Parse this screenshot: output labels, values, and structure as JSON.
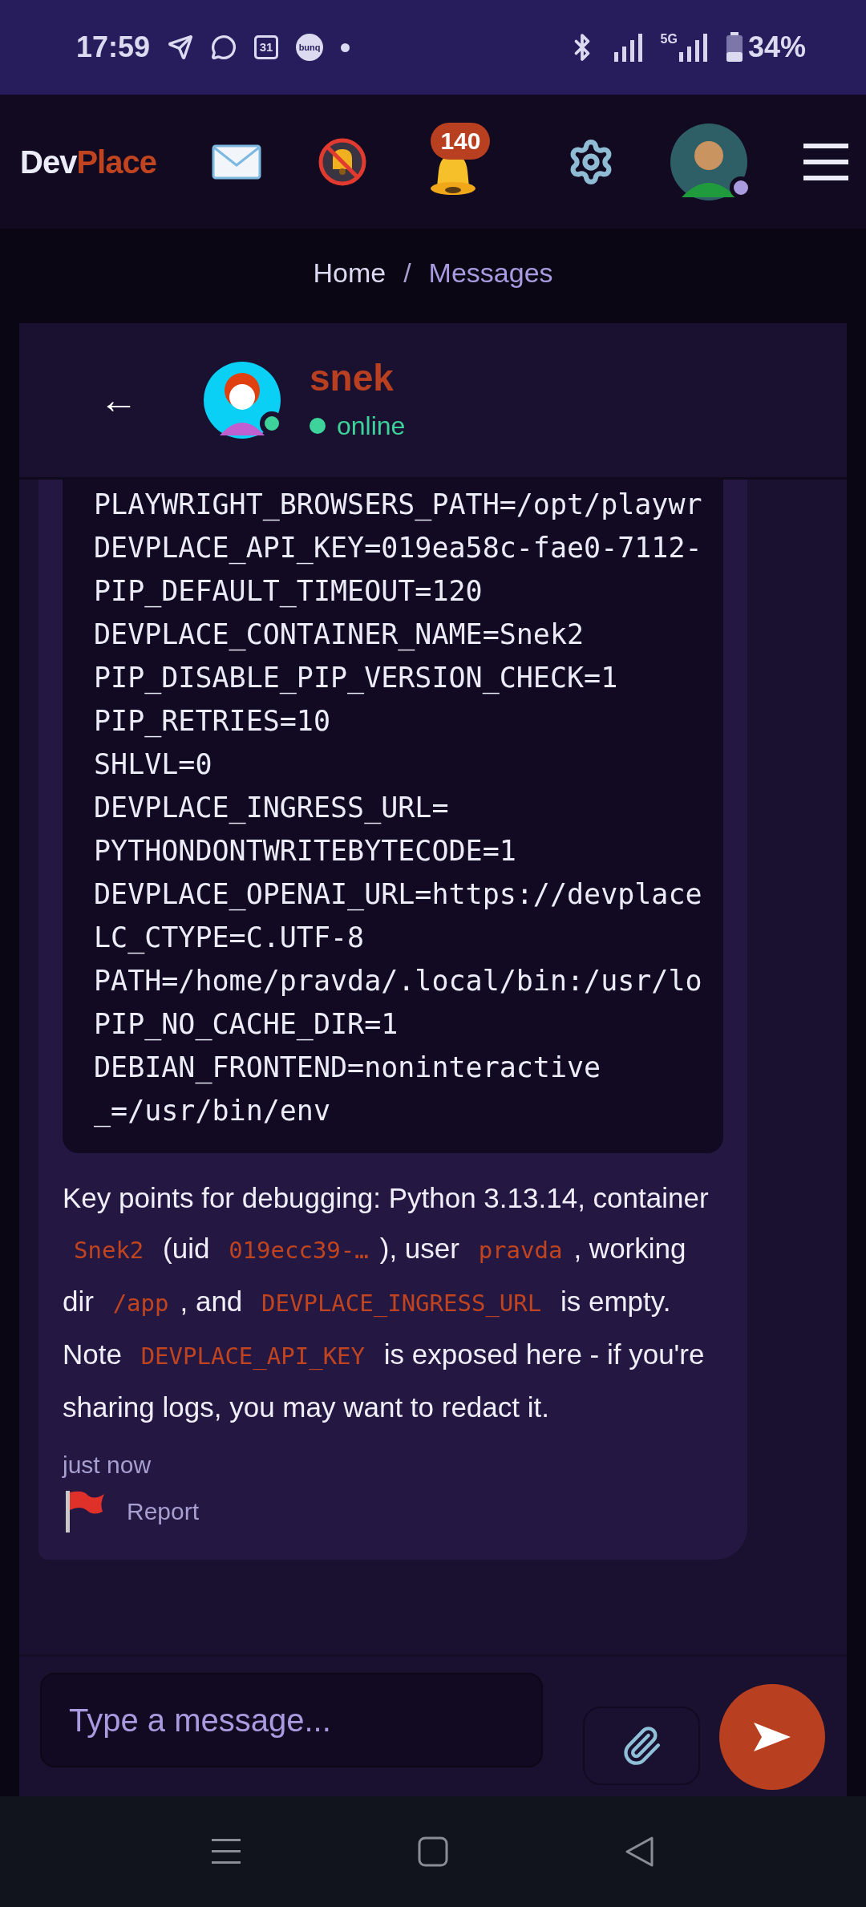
{
  "status_bar": {
    "time": "17:59",
    "calendar_day": "31",
    "app_badge": "bunq",
    "network": "5G",
    "battery": "34%"
  },
  "header": {
    "logo_first": "Dev",
    "logo_second": "Place",
    "notification_count": "140",
    "user_online": true
  },
  "breadcrumb": [
    {
      "label": "Home",
      "selected": false
    },
    {
      "label": "Messages",
      "selected": true
    }
  ],
  "breadcrumb_separator": "/",
  "chat": {
    "back": "←",
    "contact": {
      "name": "snek",
      "status": "online",
      "online": true
    }
  },
  "messages": [
    {
      "code_lines": [
        "PLAYWRIGHT_BROWSERS_PATH=/opt/playwr",
        "DEVPLACE_API_KEY=019ea58c-fae0-7112-",
        "PIP_DEFAULT_TIMEOUT=120",
        "DEVPLACE_CONTAINER_NAME=Snek2",
        "PIP_DISABLE_PIP_VERSION_CHECK=1",
        "PIP_RETRIES=10",
        "SHLVL=0",
        "DEVPLACE_INGRESS_URL=",
        "PYTHONDONTWRITEBYTECODE=1",
        "DEVPLACE_OPENAI_URL=https://devplace",
        "LC_CTYPE=C.UTF-8",
        "PATH=/home/pravda/.local/bin:/usr/lo",
        "PIP_NO_CACHE_DIR=1",
        "DEBIAN_FRONTEND=noninteractive",
        "_=/usr/bin/env"
      ],
      "segments": [
        {
          "kind": "text",
          "text": "Key points for debugging: Python 3.13.14, container "
        },
        {
          "kind": "code",
          "text": "Snek2"
        },
        {
          "kind": "text",
          "text": " (uid "
        },
        {
          "kind": "code",
          "text": "019ecc39-…"
        },
        {
          "kind": "text",
          "text": "), user "
        },
        {
          "kind": "code",
          "text": "pravda"
        },
        {
          "kind": "text",
          "text": ", working dir "
        },
        {
          "kind": "code",
          "text": "/app"
        },
        {
          "kind": "text",
          "text": ", and "
        },
        {
          "kind": "code",
          "text": "DEVPLACE_INGRESS_URL"
        },
        {
          "kind": "text",
          "text": " is empty. Note "
        },
        {
          "kind": "code",
          "text": "DEVPLACE_API_KEY"
        },
        {
          "kind": "text",
          "text": " is exposed here - if you're sharing logs, you may want to redact it."
        }
      ],
      "time": "just now",
      "report": "Report"
    }
  ],
  "composer": {
    "placeholder": "Type a message..."
  }
}
